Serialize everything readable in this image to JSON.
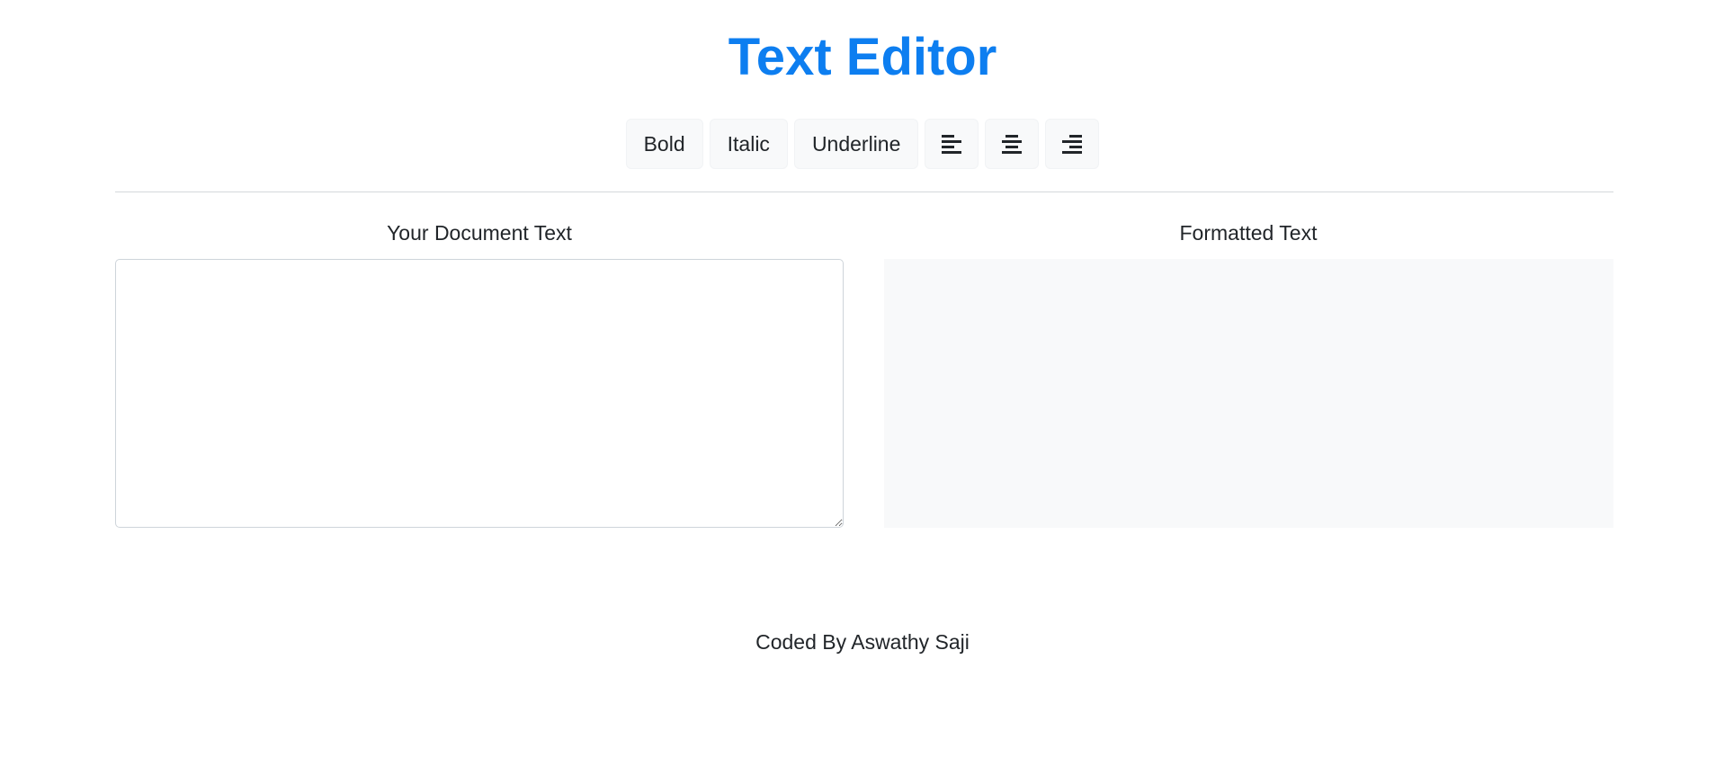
{
  "app": {
    "title": "Text Editor"
  },
  "toolbar": {
    "bold_label": "Bold",
    "italic_label": "Italic",
    "underline_label": "Underline",
    "align_left_icon": "align-left-icon",
    "align_center_icon": "align-center-icon",
    "align_right_icon": "align-right-icon"
  },
  "editor": {
    "input_label": "Your Document Text",
    "input_value": "",
    "preview_label": "Formatted Text",
    "preview_content": ""
  },
  "footer": {
    "credit": "Coded By Aswathy Saji"
  },
  "colors": {
    "accent": "#0d7ef0",
    "button_bg": "#f8f9fa",
    "preview_bg": "#f8f9fa",
    "text": "#212529"
  }
}
